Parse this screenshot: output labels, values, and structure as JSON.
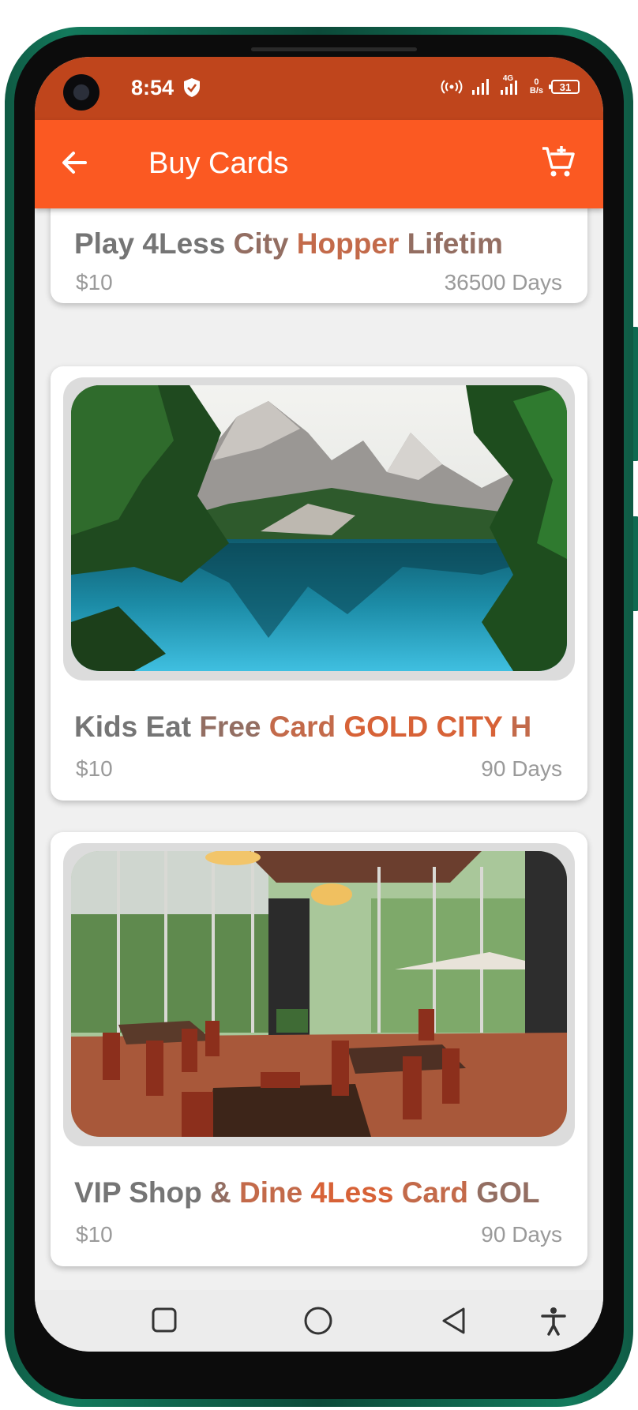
{
  "status_bar": {
    "time": "8:54",
    "network": "4G",
    "net_speed_value": "0",
    "net_speed_unit": "B/s",
    "battery": "31"
  },
  "app_bar": {
    "title": "Buy Cards"
  },
  "cards": [
    {
      "words": [
        "Play",
        "4Less",
        "City",
        "Hopper",
        "Lifetim"
      ],
      "price": "$10",
      "duration": "36500 Days"
    },
    {
      "words": [
        "Kids",
        "Eat",
        "Free",
        "Card",
        "GOLD",
        "CITY",
        "H"
      ],
      "price": "$10",
      "duration": "90 Days",
      "image": "mountain-lake"
    },
    {
      "words": [
        "VIP",
        "Shop",
        "&",
        "Dine",
        "4Less",
        "Card",
        "GOL"
      ],
      "price": "$10",
      "duration": "90 Days",
      "image": "restaurant-dining-room"
    }
  ],
  "colors": {
    "status_bar": "#bf451c",
    "app_bar": "#fb5922",
    "title_grey": "#757575",
    "title_accent": "#d76237",
    "meta_text": "#9a9a9a"
  }
}
